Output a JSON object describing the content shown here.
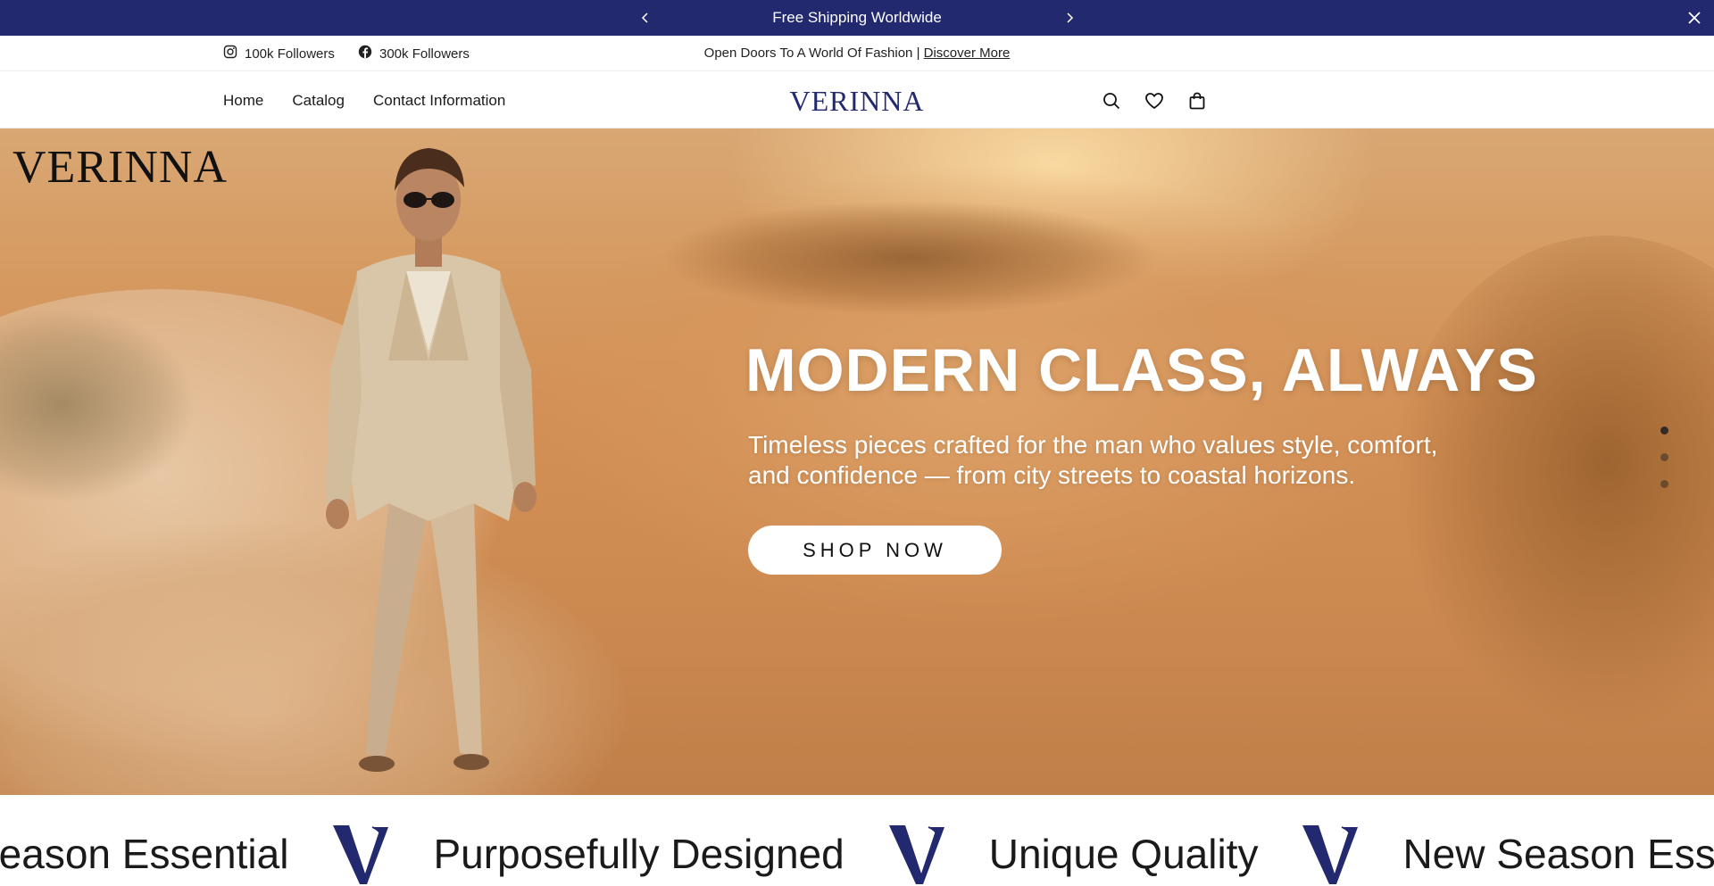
{
  "announcement": {
    "message": "Free Shipping Worldwide",
    "prev_icon": "chevron-left-icon",
    "next_icon": "chevron-right-icon",
    "close_icon": "close-icon"
  },
  "utility": {
    "instagram": {
      "icon": "instagram-icon",
      "label": "100k Followers"
    },
    "facebook": {
      "icon": "facebook-icon",
      "label": "300k Followers"
    },
    "promo_text": "Open Doors To A World Of Fashion | ",
    "promo_link": "Discover More"
  },
  "header": {
    "nav": [
      "Home",
      "Catalog",
      "Contact Information"
    ],
    "logo": "VERINNA",
    "icons": [
      "search-icon",
      "heart-icon",
      "bag-icon"
    ]
  },
  "hero": {
    "logo": "VERINNA",
    "title": "MODERN CLASS, ALWAYS",
    "subtitle": "Timeless pieces crafted for the man who values style, comfort, and confidence — from city streets to coastal horizons.",
    "button": "SHOP NOW",
    "slide_count": 3,
    "active_slide": 1
  },
  "marquee": {
    "items": [
      "Season Essential",
      "Purposefully Designed",
      "Unique Quality",
      "New Season Essential"
    ]
  },
  "colors": {
    "brand": "#22296f",
    "sand": "#d49157",
    "white": "#ffffff"
  }
}
